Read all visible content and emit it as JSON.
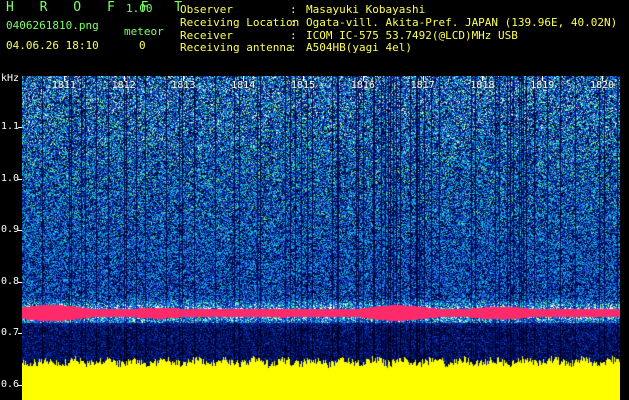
{
  "app": {
    "name": "H R O F F T",
    "version": "1.00"
  },
  "file": "0406261810.png",
  "datetime": "04.06.26 18:10",
  "meteor": {
    "label": "meteor",
    "count": "0"
  },
  "info": [
    {
      "label": "Observer",
      "value": "Masayuki Kobayashi"
    },
    {
      "label": "Receiving Location",
      "value": "Ogata-vill. Akita-Pref. JAPAN (139.96E, 40.02N)"
    },
    {
      "label": "Receiver",
      "value": "ICOM IC-575 53.7492(@LCD)MHz USB"
    },
    {
      "label": "Receiving antenna",
      "value": "A504HB(yagi 4el)"
    }
  ],
  "separator": ":",
  "axis": {
    "unit": "kHz",
    "y_labels": [
      "1.1",
      "1.0",
      "0.9",
      "0.8",
      "0.7",
      "0.6"
    ],
    "y_values": [
      1.1,
      1.0,
      0.9,
      0.8,
      0.7,
      0.6
    ],
    "y_range": [
      0.57,
      1.2
    ],
    "time_labels": [
      "1811",
      "1812",
      "1813",
      "1814",
      "1815",
      "1816",
      "1817",
      "1818",
      "1819",
      "1820"
    ],
    "time_range": [
      1810.3,
      1820.3
    ]
  },
  "colors": {
    "background": "#000000",
    "header_green": "#7cff66",
    "header_yellow": "#ffff55",
    "carrier": "#ff2a6a",
    "noise_floor": "#ffff00"
  }
}
